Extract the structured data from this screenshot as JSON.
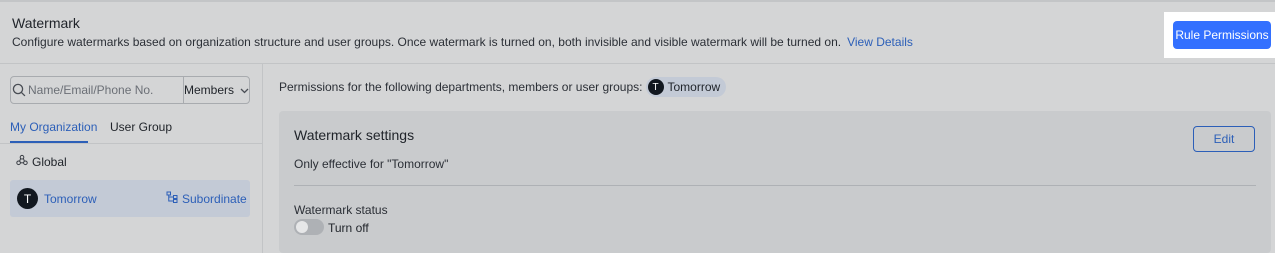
{
  "header": {
    "title": "Watermark",
    "description": "Configure watermarks based on organization structure and user groups. Once watermark is turned on, both invisible and visible watermark will be turned on.",
    "link_label": "View Details",
    "rule_button_label": "Rule Permissions"
  },
  "sidebar": {
    "search_placeholder": "Name/Email/Phone No.",
    "search_value": "",
    "filter_label": "Members",
    "tabs": [
      {
        "label": "My Organization",
        "active": true
      },
      {
        "label": "User Group",
        "active": false
      }
    ],
    "global_label": "Global",
    "selected_item": {
      "avatar_letter": "T",
      "name": "Tomorrow",
      "action_label": "Subordinate"
    }
  },
  "main": {
    "permission_text": "Permissions for the following departments, members or user groups:",
    "chip": {
      "avatar_letter": "T",
      "name": "Tomorrow"
    },
    "settings": {
      "title": "Watermark settings",
      "edit_label": "Edit",
      "subtitle": "Only effective for \"Tomorrow\"",
      "status_label": "Watermark status",
      "status_value": "Turn off",
      "status_on": false
    }
  },
  "colors": {
    "accent": "#3370ff",
    "link": "#2c5fb8",
    "background": "#d4d5d6"
  },
  "icons": [
    "search-icon",
    "chevron-down-icon",
    "global-icon",
    "subordinate-icon"
  ]
}
